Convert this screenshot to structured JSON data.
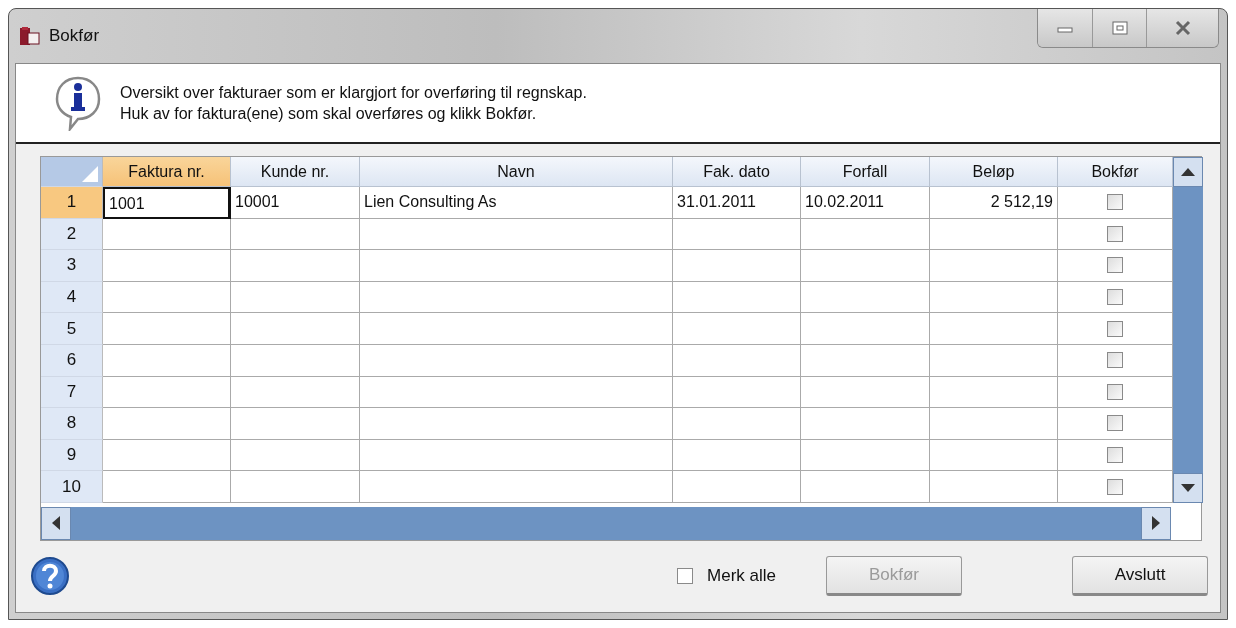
{
  "window": {
    "title": "Bokfør"
  },
  "info": {
    "lines": [
      "Oversikt over fakturaer som er klargjort for overføring til regnskap.",
      "Huk av for faktura(ene) som skal overføres og klikk Bokfør."
    ]
  },
  "table": {
    "columns": [
      {
        "label": "Faktura nr.",
        "selected": true
      },
      {
        "label": "Kunde nr.",
        "selected": false
      },
      {
        "label": "Navn",
        "selected": false
      },
      {
        "label": "Fak. dato",
        "selected": false
      },
      {
        "label": "Forfall",
        "selected": false
      },
      {
        "label": "Beløp",
        "selected": false
      },
      {
        "label": "Bokfør",
        "selected": false
      }
    ],
    "rows": [
      {
        "number": "1",
        "selected": true,
        "cells": [
          "1001",
          "10001",
          "Lien Consulting As",
          "31.01.2011",
          "10.02.2011",
          "2 512,19"
        ],
        "checked": false
      },
      {
        "number": "2",
        "selected": false,
        "cells": [],
        "checked": false
      },
      {
        "number": "3",
        "selected": false,
        "cells": [],
        "checked": false
      },
      {
        "number": "4",
        "selected": false,
        "cells": [],
        "checked": false
      },
      {
        "number": "5",
        "selected": false,
        "cells": [],
        "checked": false
      },
      {
        "number": "6",
        "selected": false,
        "cells": [],
        "checked": false
      },
      {
        "number": "7",
        "selected": false,
        "cells": [],
        "checked": false
      },
      {
        "number": "8",
        "selected": false,
        "cells": [],
        "checked": false
      },
      {
        "number": "9",
        "selected": false,
        "cells": [],
        "checked": false
      },
      {
        "number": "10",
        "selected": false,
        "cells": [],
        "checked": false
      }
    ]
  },
  "footer": {
    "select_all": {
      "label": "Merk alle",
      "checked": false
    },
    "buttons": [
      {
        "label": "Bokfør",
        "disabled": true
      },
      {
        "label": "Avslutt",
        "disabled": false
      }
    ]
  }
}
